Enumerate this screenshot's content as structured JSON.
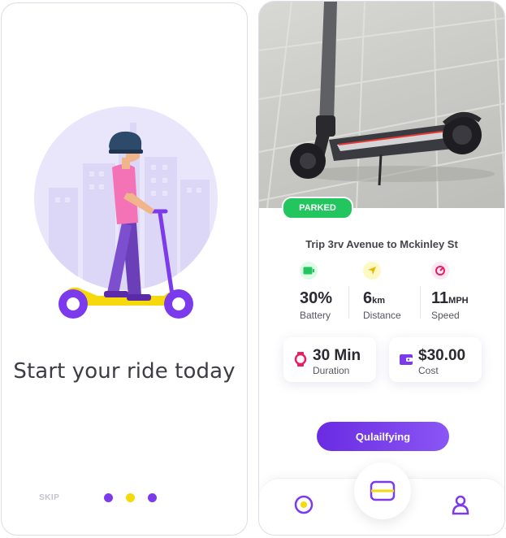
{
  "onboarding": {
    "title": "Start your ride today",
    "skip_label": "SKIP",
    "dots": [
      {
        "color": "#7c3aed"
      },
      {
        "color": "#f5d90a"
      },
      {
        "color": "#7c3aed"
      }
    ]
  },
  "ride": {
    "status_badge": "PARKED",
    "trip_title": "Trip 3rv Avenue to Mckinley St",
    "stats": [
      {
        "icon": "battery-icon",
        "value": "30%",
        "unit": "",
        "label": "Battery",
        "color": "#22c55e"
      },
      {
        "icon": "location-arrow-icon",
        "value": "6",
        "unit": "km",
        "label": "Distance",
        "color": "#f5d90a"
      },
      {
        "icon": "speedometer-icon",
        "value": "11",
        "unit": "MPH",
        "label": "Speed",
        "color": "#e91e63"
      }
    ],
    "cards": [
      {
        "icon": "watch-icon",
        "value": "30 Min",
        "label": "Duration",
        "color": "#e91e63"
      },
      {
        "icon": "wallet-icon",
        "value": "$30.00",
        "label": "Cost",
        "color": "#7c3aed"
      }
    ],
    "cta_label": "Qulailfying"
  },
  "tabbar": {
    "items": [
      {
        "icon": "location-pin-icon"
      },
      {
        "icon": "scan-card-icon"
      },
      {
        "icon": "profile-icon"
      }
    ]
  },
  "colors": {
    "accent": "#7c3aed",
    "green": "#22c55e",
    "yellow": "#f5d90a",
    "pink": "#e91e63"
  }
}
